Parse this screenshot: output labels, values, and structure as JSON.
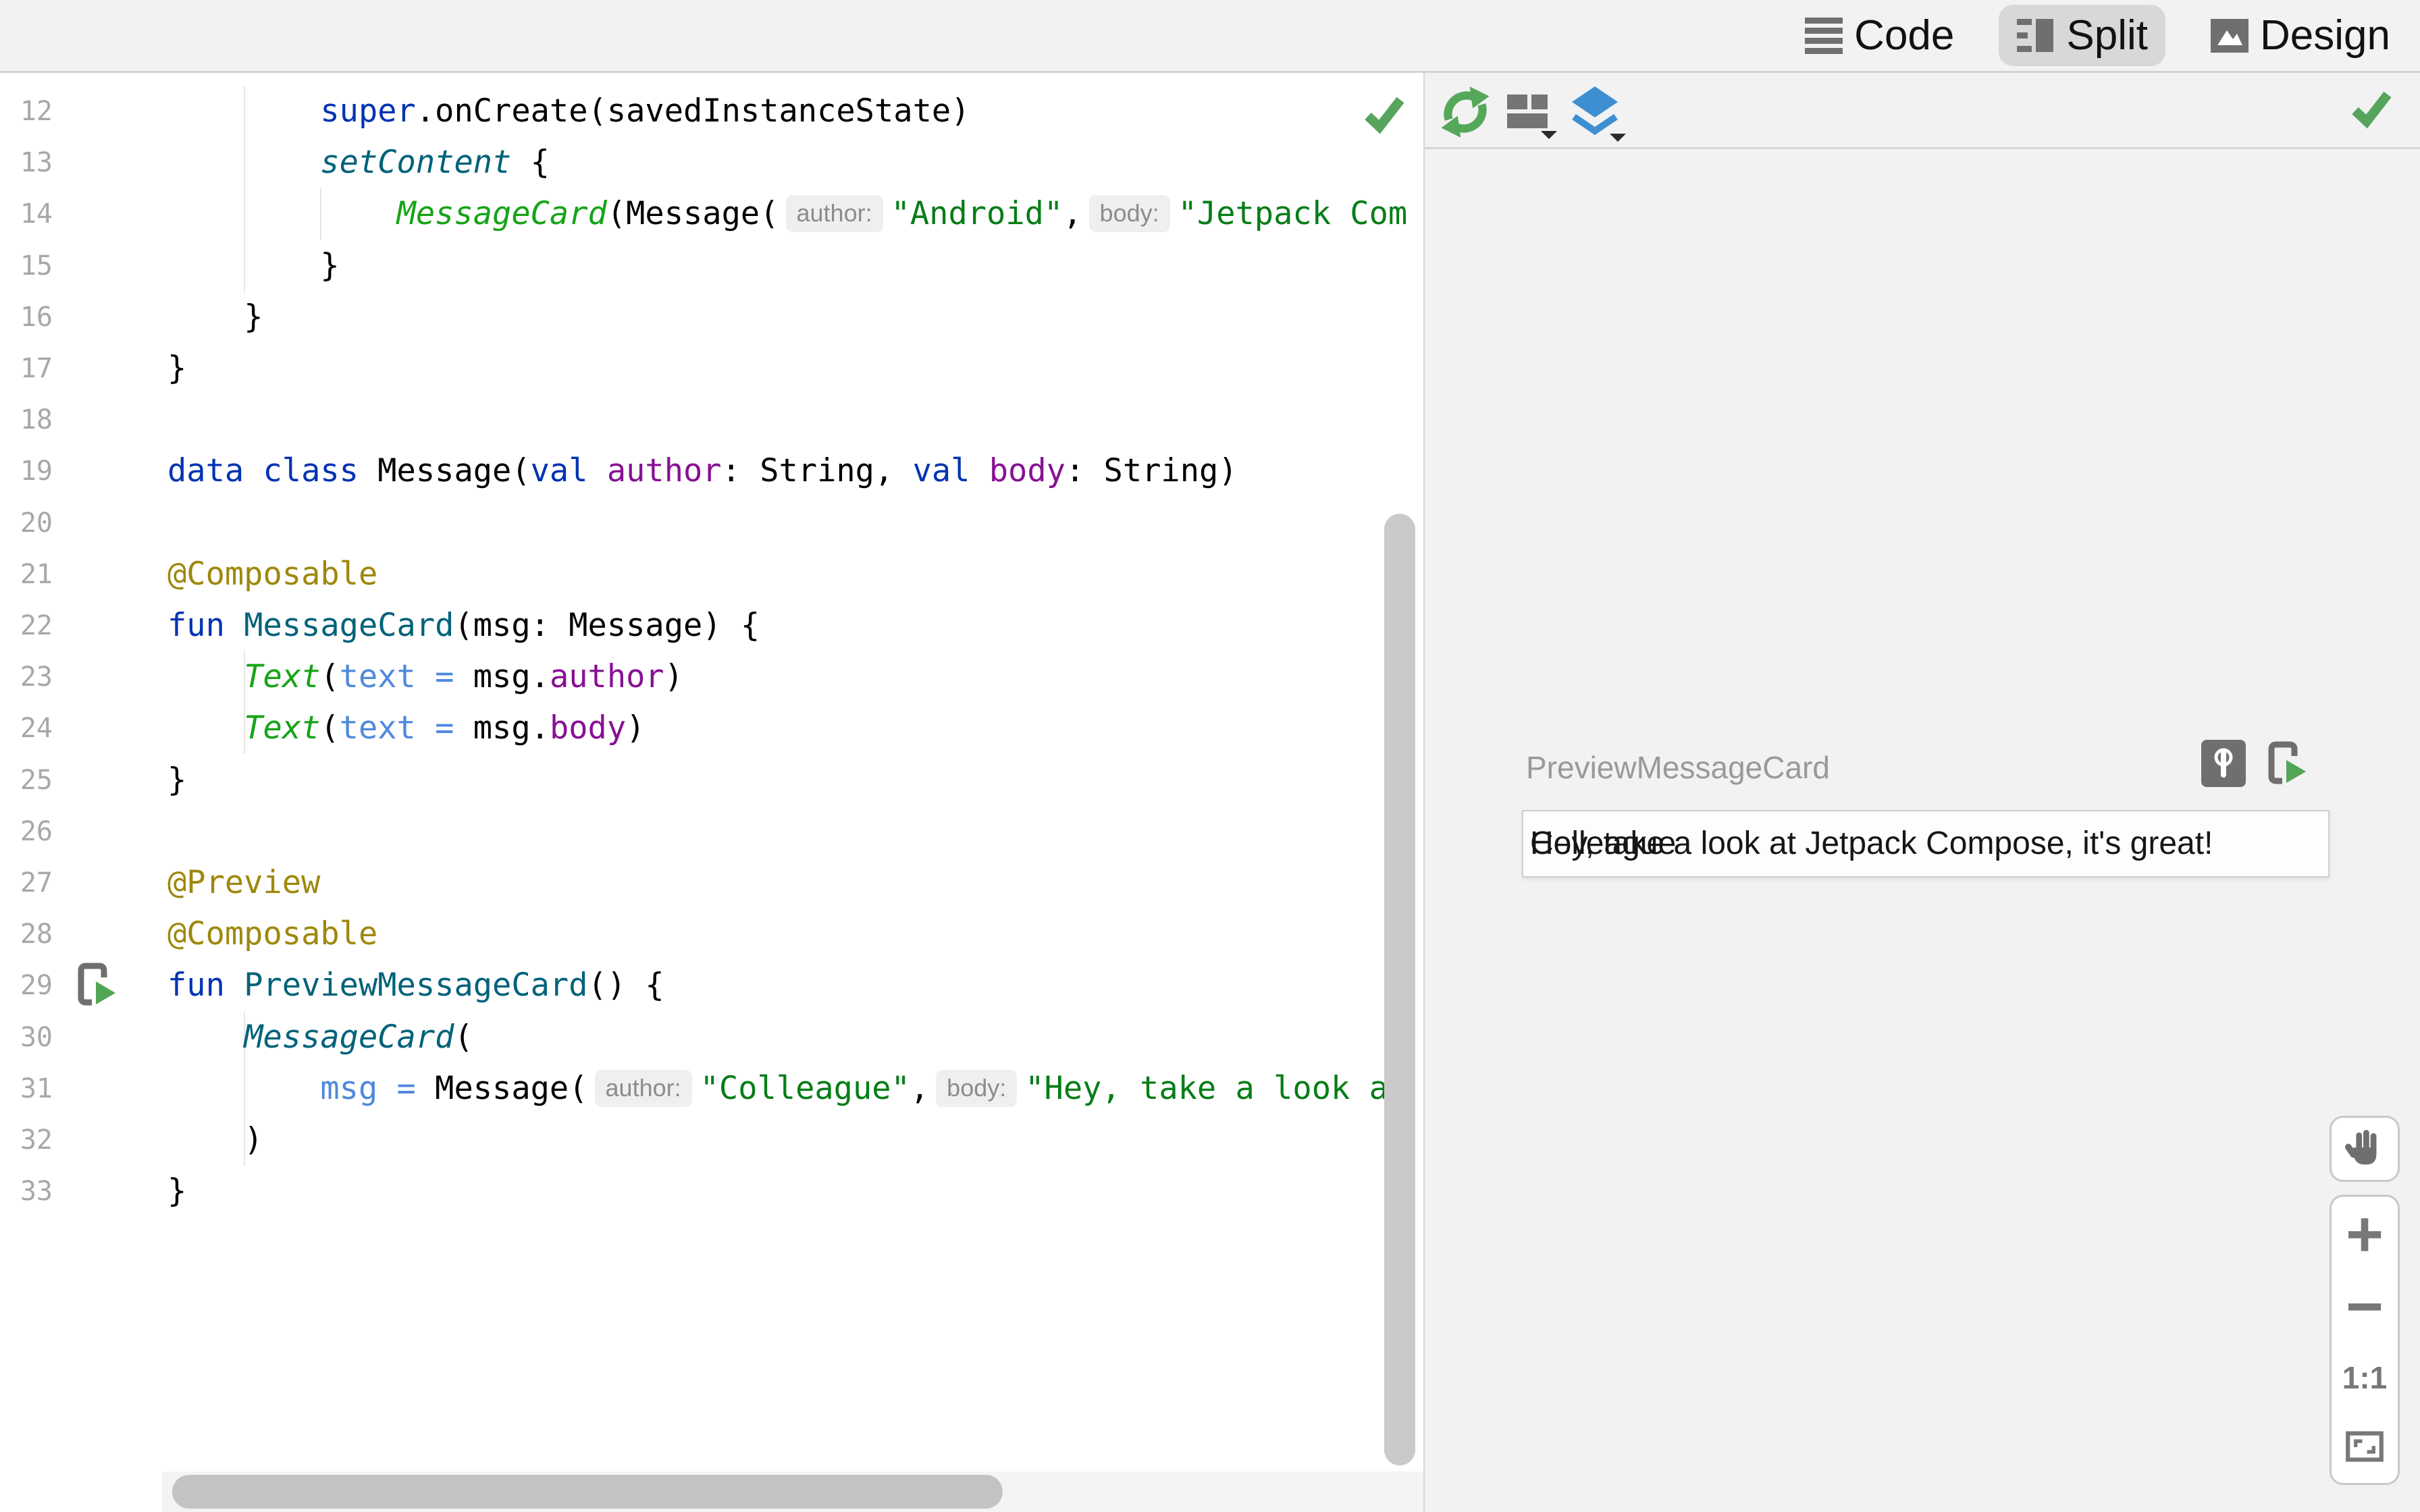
{
  "view_tabs": {
    "code": "Code",
    "split": "Split",
    "design": "Design",
    "selected": "Split"
  },
  "editor": {
    "lines": [
      {
        "num": 12,
        "indent": 8,
        "tokens": [
          {
            "c": "kw",
            "t": "super"
          },
          {
            "c": "pl",
            "t": ".onCreate(savedInstanceState)"
          }
        ]
      },
      {
        "num": 13,
        "indent": 8,
        "tokens": [
          {
            "c": "fni",
            "t": "setContent"
          },
          {
            "c": "pl",
            "t": " {"
          }
        ]
      },
      {
        "num": 14,
        "indent": 12,
        "tokens": [
          {
            "c": "comp",
            "t": "MessageCard"
          },
          {
            "c": "pl",
            "t": "(Message("
          },
          {
            "c": "hint",
            "t": "author:"
          },
          {
            "c": "str",
            "t": "\"Android\""
          },
          {
            "c": "pl",
            "t": ","
          },
          {
            "c": "hint",
            "t": "body:"
          },
          {
            "c": "str",
            "t": "\"Jetpack Com"
          }
        ]
      },
      {
        "num": 15,
        "indent": 8,
        "tokens": [
          {
            "c": "pl",
            "t": "}"
          }
        ]
      },
      {
        "num": 16,
        "indent": 4,
        "tokens": [
          {
            "c": "pl",
            "t": "}"
          }
        ]
      },
      {
        "num": 17,
        "indent": 0,
        "tokens": [
          {
            "c": "pl",
            "t": "}"
          }
        ]
      },
      {
        "num": 18,
        "indent": 0,
        "tokens": []
      },
      {
        "num": 19,
        "indent": 0,
        "tokens": [
          {
            "c": "kw",
            "t": "data"
          },
          {
            "c": "pl",
            "t": " "
          },
          {
            "c": "kw",
            "t": "class"
          },
          {
            "c": "pl",
            "t": " Message("
          },
          {
            "c": "kw",
            "t": "val"
          },
          {
            "c": "pl",
            "t": " "
          },
          {
            "c": "prop",
            "t": "author"
          },
          {
            "c": "pl",
            "t": ": String, "
          },
          {
            "c": "kw",
            "t": "val"
          },
          {
            "c": "pl",
            "t": " "
          },
          {
            "c": "prop",
            "t": "body"
          },
          {
            "c": "pl",
            "t": ": String)"
          }
        ]
      },
      {
        "num": 20,
        "indent": 0,
        "tokens": []
      },
      {
        "num": 21,
        "indent": 0,
        "tokens": [
          {
            "c": "ann",
            "t": "@Composable"
          }
        ]
      },
      {
        "num": 22,
        "indent": 0,
        "tokens": [
          {
            "c": "kw",
            "t": "fun"
          },
          {
            "c": "pl",
            "t": " "
          },
          {
            "c": "fn",
            "t": "MessageCard"
          },
          {
            "c": "pl",
            "t": "(msg: Message) {"
          }
        ]
      },
      {
        "num": 23,
        "indent": 4,
        "tokens": [
          {
            "c": "comp",
            "t": "Text"
          },
          {
            "c": "pl",
            "t": "("
          },
          {
            "c": "named",
            "t": "text = "
          },
          {
            "c": "pl",
            "t": "msg."
          },
          {
            "c": "prop",
            "t": "author"
          },
          {
            "c": "pl",
            "t": ")"
          }
        ]
      },
      {
        "num": 24,
        "indent": 4,
        "tokens": [
          {
            "c": "comp",
            "t": "Text"
          },
          {
            "c": "pl",
            "t": "("
          },
          {
            "c": "named",
            "t": "text = "
          },
          {
            "c": "pl",
            "t": "msg."
          },
          {
            "c": "prop",
            "t": "body"
          },
          {
            "c": "pl",
            "t": ")"
          }
        ]
      },
      {
        "num": 25,
        "indent": 0,
        "tokens": [
          {
            "c": "pl",
            "t": "}"
          }
        ]
      },
      {
        "num": 26,
        "indent": 0,
        "tokens": []
      },
      {
        "num": 27,
        "indent": 0,
        "tokens": [
          {
            "c": "ann",
            "t": "@Preview"
          }
        ]
      },
      {
        "num": 28,
        "indent": 0,
        "tokens": [
          {
            "c": "ann",
            "t": "@Composable"
          }
        ]
      },
      {
        "num": 29,
        "indent": 0,
        "run_icon": true,
        "tokens": [
          {
            "c": "kw",
            "t": "fun"
          },
          {
            "c": "pl",
            "t": " "
          },
          {
            "c": "fn",
            "t": "PreviewMessageCard"
          },
          {
            "c": "pl",
            "t": "() {"
          }
        ]
      },
      {
        "num": 30,
        "indent": 4,
        "tokens": [
          {
            "c": "fni",
            "t": "MessageCard"
          },
          {
            "c": "pl",
            "t": "("
          }
        ]
      },
      {
        "num": 31,
        "indent": 8,
        "tokens": [
          {
            "c": "named",
            "t": "msg = "
          },
          {
            "c": "pl",
            "t": "Message("
          },
          {
            "c": "hint",
            "t": "author:"
          },
          {
            "c": "str",
            "t": "\"Colleague\""
          },
          {
            "c": "pl",
            "t": ","
          },
          {
            "c": "hint",
            "t": "body:"
          },
          {
            "c": "str",
            "t": "\"Hey, take a look at"
          }
        ]
      },
      {
        "num": 32,
        "indent": 4,
        "tokens": [
          {
            "c": "pl",
            "t": ")"
          }
        ]
      },
      {
        "num": 33,
        "indent": 0,
        "tokens": [
          {
            "c": "pl",
            "t": "}"
          }
        ]
      }
    ]
  },
  "preview": {
    "label": "PreviewMessageCard",
    "author_text": "Colleague",
    "body_text": "Hey, take a look at Jetpack Compose, it's great!"
  },
  "zoom_controls": {
    "zoom_in": "+",
    "zoom_out": "−",
    "actual_size": "1:1"
  },
  "icons": {
    "topbar": [
      "code-lines-icon",
      "split-view-icon",
      "design-image-icon"
    ],
    "preview_toolbar": [
      "build-refresh-icon",
      "layout-options-icon",
      "layers-icon",
      "render-status-check-icon"
    ],
    "preview_actions": [
      "interactive-mode-icon",
      "run-preview-on-device-icon"
    ],
    "editor": [
      "inspections-check-icon",
      "run-preview-gutter-icon"
    ],
    "zoom": [
      "pan-hand-icon",
      "zoom-to-fit-icon"
    ]
  },
  "colors": {
    "keyword": "#0033b3",
    "function_decl": "#00627a",
    "composable_call": "#17a317",
    "string": "#067d17",
    "annotation": "#9e880d",
    "named_argument": "#4f89dc",
    "property": "#871094",
    "hint_text": "#8c8c8c",
    "hint_bg": "#efefef",
    "status_green": "#57a45c",
    "layers_blue": "#3d8fd1",
    "panel_bg": "#f2f2f2"
  }
}
